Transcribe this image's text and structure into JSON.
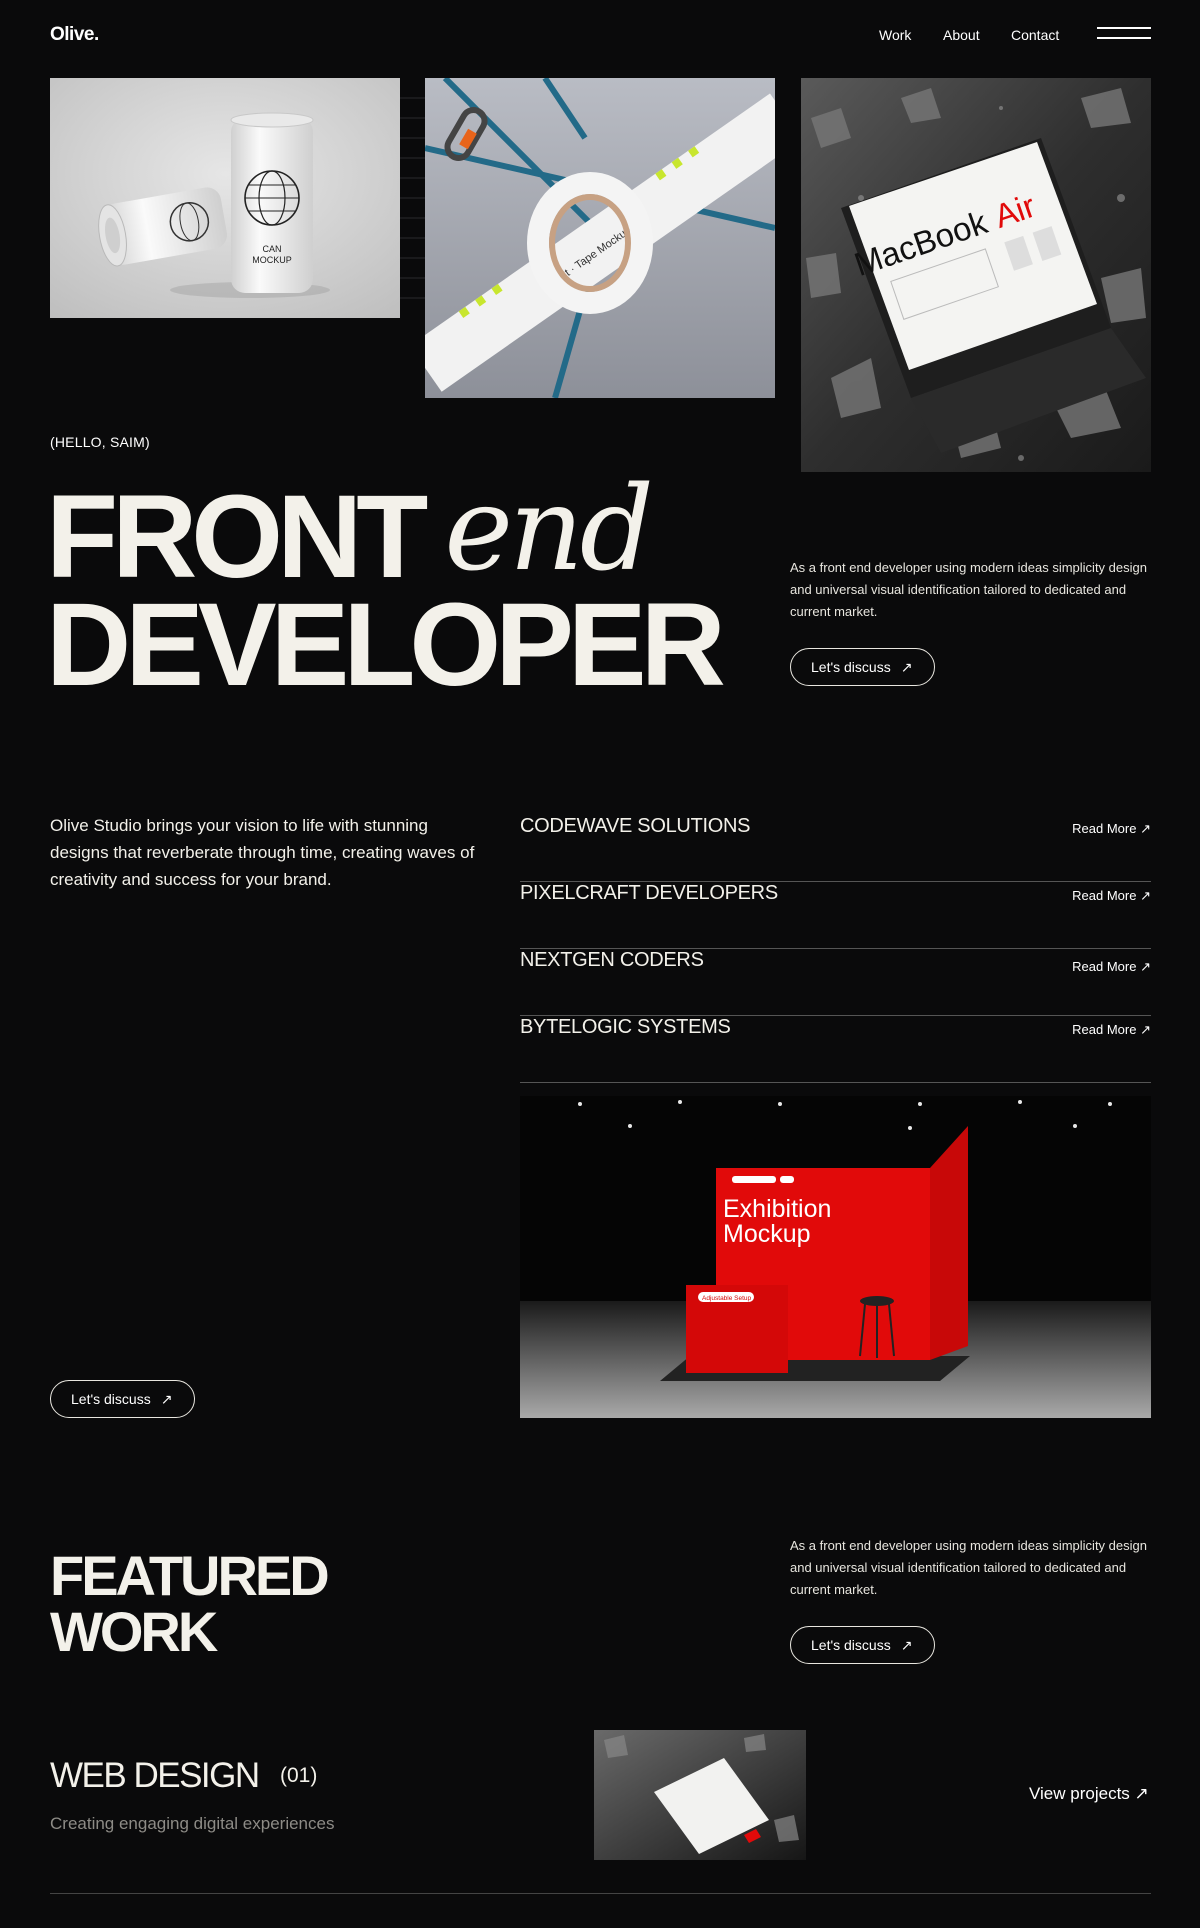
{
  "header": {
    "logo": "Olive.",
    "nav": [
      "Work",
      "About",
      "Contact"
    ],
    "menu_icon": "hamburger-icon"
  },
  "hero": {
    "greeting": "(HELLO, SAIM)",
    "title_line1": "FRONT",
    "title_italic": "end",
    "title_line2": "DEVELOPER",
    "description": "As a front end developer using modern ideas simplicity design and universal visual identification tailored to dedicated and current market.",
    "cta": "Let's discuss"
  },
  "images": {
    "can_label_1": "CAN",
    "can_label_2": "MOCKUP",
    "macbook_title_1": "MacBook",
    "macbook_title_2": "Air",
    "exhibition_title_1": "Exhibition",
    "exhibition_title_2": "Mockup",
    "exhibition_tag": "Adjustable Setup"
  },
  "services": {
    "intro": "Olive Studio brings your vision to life with stunning designs that reverberate through time, creating waves of creativity and success for your brand.",
    "read_more": "Read More",
    "items": [
      {
        "name": "CODEWAVE SOLUTIONS"
      },
      {
        "name": "PIXELCRAFT DEVELOPERS"
      },
      {
        "name": "NEXTGEN CODERS"
      },
      {
        "name": "BYTELOGIC SYSTEMS"
      }
    ],
    "cta": "Let's discuss"
  },
  "featured": {
    "title_line1": "FEATURED",
    "title_line2": "WORK",
    "description": "As a front end developer using modern ideas simplicity design and universal visual identification tailored to dedicated and current market.",
    "cta": "Let's discuss",
    "project": {
      "title": "WEB DESIGN",
      "number": "(01)",
      "subtitle": "Creating engaging digital experiences",
      "link": "View projects"
    }
  },
  "colors": {
    "background": "#0a0a0b",
    "text": "#f3f1ea",
    "accent_red": "#e10a0a",
    "divider": "#555555"
  }
}
